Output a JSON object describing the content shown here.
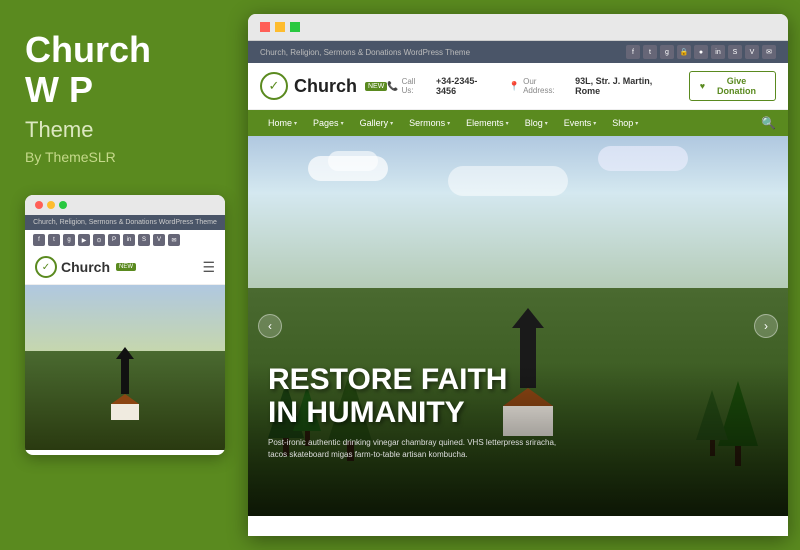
{
  "left": {
    "title_line1": "Church",
    "title_line2": "W P",
    "subtitle": "Theme",
    "by": "By ThemeSLR"
  },
  "browser": {
    "tagline": "Church, Religion, Sermons & Donations WordPress Theme",
    "social_icons": [
      "f",
      "t",
      "g+",
      "🔒",
      "●",
      "in",
      "●",
      "●",
      "●"
    ],
    "logo_text": "Church",
    "logo_badge": "NEW",
    "contact": {
      "call_label": "Call Us:",
      "call_value": "+34-2345-3456",
      "address_label": "Our Address:",
      "address_value": "93L, Str. J. Martin, Rome"
    },
    "donate_btn": "Give Donation",
    "nav_items": [
      {
        "label": "Home",
        "has_arrow": true
      },
      {
        "label": "Pages",
        "has_arrow": true
      },
      {
        "label": "Gallery",
        "has_arrow": true
      },
      {
        "label": "Sermons",
        "has_arrow": true
      },
      {
        "label": "Elements",
        "has_arrow": true
      },
      {
        "label": "Blog",
        "has_arrow": true
      },
      {
        "label": "Events",
        "has_arrow": true
      },
      {
        "label": "Shop",
        "has_arrow": true
      }
    ],
    "hero": {
      "title_line1": "RESTORE FAITH",
      "title_line2": "IN HUMANITY",
      "subtitle": "Post-ironic authentic drinking vinegar chambray quined. VHS letterpress sriracha, tacos skateboard migas farm-to-table artisan kombucha."
    }
  },
  "mobile": {
    "tagline": "Church, Religion, Sermons & Donations WordPress Theme",
    "logo_text": "Church",
    "logo_badge": "NEW"
  },
  "colors": {
    "green": "#5a8a1f",
    "dark_nav": "#4a5568",
    "white": "#ffffff"
  }
}
